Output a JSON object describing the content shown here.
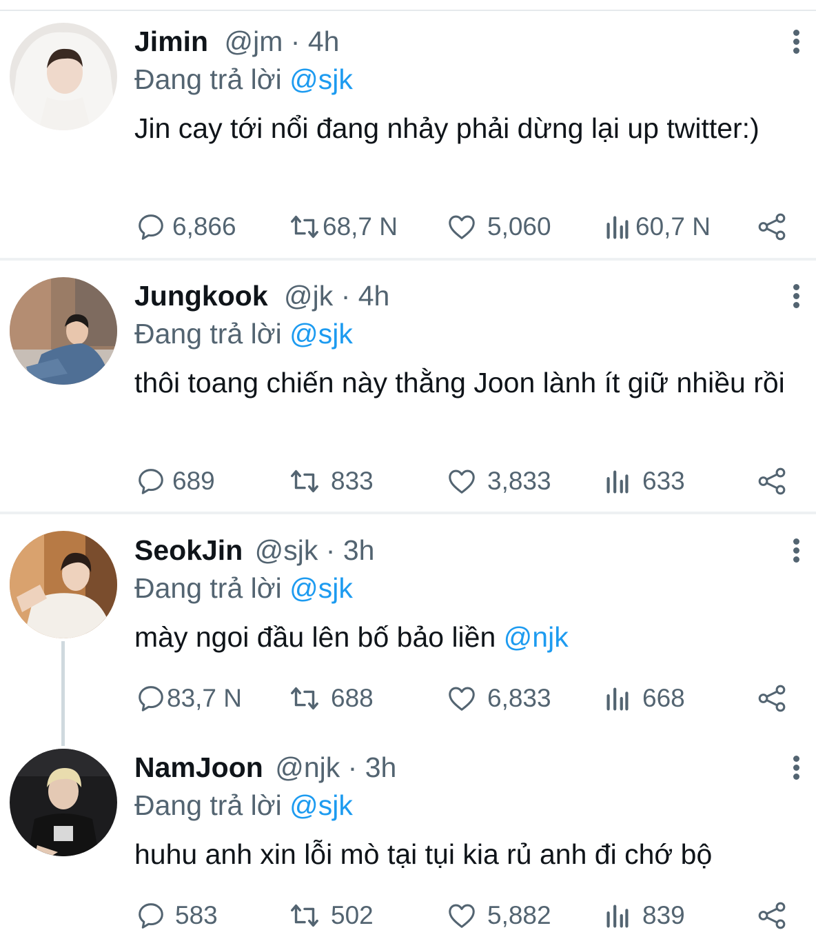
{
  "tweets": [
    {
      "name": "Jimin",
      "handle": "@jm",
      "dot": "·",
      "time": "4h",
      "reply_prefix": "Đang trả lời",
      "reply_to": "@sjk",
      "text": "Jin cay tới nổi đang nhảy phải dừng lại up twitter:)",
      "text_mention": "",
      "stats": {
        "replies": "6,866",
        "retweets": "68,7 N",
        "likes": "5,060",
        "views": "60,7 N"
      },
      "avatar_colors": {
        "bg": "#e9e6e3",
        "skin": "#efd9cb",
        "hair": "#3a2a22",
        "shirt": "#f4f2ef"
      }
    },
    {
      "name": "Jungkook",
      "handle": "@jk",
      "dot": "·",
      "time": "4h",
      "reply_prefix": "Đang trả lời",
      "reply_to": "@sjk",
      "text": "thôi toang chiến này thằng Joon lành ít giữ nhiều rồi",
      "text_mention": "",
      "stats": {
        "replies": "689",
        "retweets": "833",
        "likes": "3,833",
        "views": "633"
      },
      "avatar_colors": {
        "bg": "#9a7c66",
        "skin": "#e8c6ad",
        "hair": "#1e1a18",
        "shirt": "#4f6f95"
      }
    },
    {
      "name": "SeokJin",
      "handle": "@sjk",
      "dot": "·",
      "time": "3h",
      "reply_prefix": "Đang trả lời",
      "reply_to": "@sjk",
      "text": "mày ngoi đầu lên bố bảo liền ",
      "text_mention": "@njk",
      "stats": {
        "replies": "83,7 N",
        "retweets": "688",
        "likes": "6,833",
        "views": "668"
      },
      "avatar_colors": {
        "bg": "#b77a45",
        "skin": "#eed2bd",
        "hair": "#2a1d17",
        "shirt": "#f3efe9"
      }
    },
    {
      "name": "NamJoon",
      "handle": "@njk",
      "dot": "·",
      "time": "3h",
      "reply_prefix": "Đang trả lời",
      "reply_to": "@sjk",
      "text": "huhu anh xin lỗi mò tại tụi kia rủ anh đi chớ bộ",
      "text_mention": "",
      "stats": {
        "replies": "583",
        "retweets": "502",
        "likes": "5,882",
        "views": "839"
      },
      "avatar_colors": {
        "bg": "#1c1c1e",
        "skin": "#e4c9b4",
        "hair": "#e9dcae",
        "shirt": "#121212"
      }
    }
  ],
  "colors": {
    "text": "#0f1419",
    "muted": "#536471",
    "link": "#1d9bf0",
    "divider": "#eef1f3"
  },
  "icons": [
    "reply-icon",
    "retweet-icon",
    "like-icon",
    "views-icon",
    "share-icon",
    "more-icon"
  ]
}
